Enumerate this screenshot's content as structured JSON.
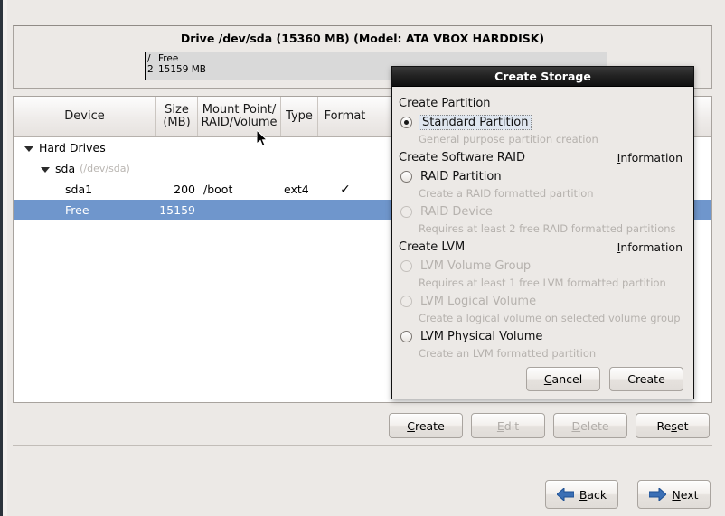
{
  "drive_panel": {
    "title": "Drive /dev/sda (15360 MB) (Model: ATA VBOX HARDDISK)",
    "segments": [
      {
        "name": "boot-segment",
        "line1": "/",
        "line2": "2"
      },
      {
        "name": "free-segment",
        "line1": "Free",
        "line2": "15159 MB"
      }
    ]
  },
  "table": {
    "headers": {
      "device": "Device",
      "size": "Size\n(MB)",
      "size_line1": "Size",
      "size_line2": "(MB)",
      "mount_line1": "Mount Point/",
      "mount_line2": "RAID/Volume",
      "type": "Type",
      "format": "Format"
    },
    "rows": [
      {
        "device": "Hard Drives",
        "path": "",
        "size": "",
        "mount": "",
        "type": "",
        "format": "",
        "level": 0,
        "expander": true,
        "selected": false
      },
      {
        "device": "sda",
        "path": "(/dev/sda)",
        "size": "",
        "mount": "",
        "type": "",
        "format": "",
        "level": 1,
        "expander": true,
        "selected": false
      },
      {
        "device": "sda1",
        "path": "",
        "size": "200",
        "mount": "/boot",
        "type": "ext4",
        "format": "✓",
        "level": 2,
        "expander": false,
        "selected": false
      },
      {
        "device": "Free",
        "path": "",
        "size": "15159",
        "mount": "",
        "type": "",
        "format": "",
        "level": 2,
        "expander": false,
        "selected": true
      }
    ]
  },
  "action_buttons": [
    {
      "name": "create-button",
      "label_pre": "",
      "label_mnemonic": "C",
      "label_post": "reate",
      "disabled": false
    },
    {
      "name": "edit-button",
      "label_pre": "",
      "label_mnemonic": "E",
      "label_post": "dit",
      "disabled": true
    },
    {
      "name": "delete-button",
      "label_pre": "",
      "label_mnemonic": "D",
      "label_post": "elete",
      "disabled": true
    },
    {
      "name": "reset-button",
      "label_pre": "Re",
      "label_mnemonic": "s",
      "label_post": "et",
      "disabled": false
    }
  ],
  "nav_buttons": {
    "back": {
      "label_pre": "",
      "label_mnemonic": "B",
      "label_post": "ack",
      "icon": "arrow-left-icon"
    },
    "next": {
      "label_pre": "",
      "label_mnemonic": "N",
      "label_post": "ext",
      "icon": "arrow-right-icon"
    }
  },
  "dialog": {
    "title": "Create Storage",
    "groups": [
      {
        "heading": "Create Partition",
        "info": null,
        "options": [
          {
            "name": "standard-partition",
            "label": "Standard Partition",
            "description": "General purpose partition creation",
            "checked": true,
            "disabled": false,
            "focused": true
          }
        ]
      },
      {
        "heading": "Create Software RAID",
        "info": {
          "pre": "",
          "mnemonic": "I",
          "post": "nformation"
        },
        "options": [
          {
            "name": "raid-partition",
            "label": "RAID Partition",
            "description": "Create a RAID formatted partition",
            "checked": false,
            "disabled": false,
            "focused": false
          },
          {
            "name": "raid-device",
            "label": "RAID Device",
            "description": "Requires at least 2 free RAID formatted partitions",
            "checked": false,
            "disabled": true,
            "focused": false
          }
        ]
      },
      {
        "heading": "Create LVM",
        "info": {
          "pre": "",
          "mnemonic": "I",
          "post": "nformation"
        },
        "options": [
          {
            "name": "lvm-volume-group",
            "label": "LVM Volume Group",
            "description": "Requires at least 1 free LVM formatted partition",
            "checked": false,
            "disabled": true,
            "focused": false
          },
          {
            "name": "lvm-logical-volume",
            "label": "LVM Logical Volume",
            "description": "Create a logical volume on selected volume group",
            "checked": false,
            "disabled": true,
            "focused": false
          },
          {
            "name": "lvm-physical-volume",
            "label": "LVM Physical Volume",
            "description": "Create an LVM formatted partition",
            "checked": false,
            "disabled": false,
            "focused": false
          }
        ]
      }
    ],
    "buttons": [
      {
        "name": "dialog-cancel-button",
        "label_pre": "",
        "label_mnemonic": "C",
        "label_post": "ancel"
      },
      {
        "name": "dialog-create-button",
        "label_pre": "Create",
        "label_mnemonic": "",
        "label_post": ""
      }
    ]
  },
  "colors": {
    "selection_blue": "#6f96cc",
    "window_bg": "#ece9e6",
    "titlebar_dark": "#111111",
    "nav_arrow_blue": "#3b6fb5"
  }
}
